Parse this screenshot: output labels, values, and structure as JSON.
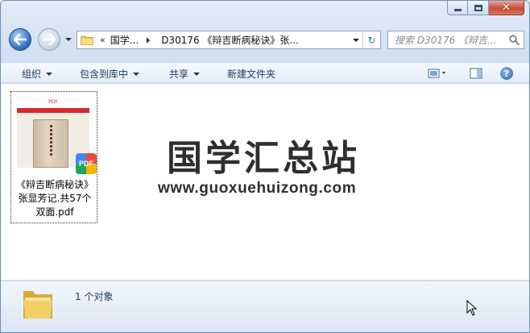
{
  "window": {
    "caption": {
      "minimize": "minimize",
      "maximize": "maximize",
      "close": "✕"
    }
  },
  "nav": {
    "address": {
      "chevrons": "«",
      "crumb1": "国学...",
      "crumb2": "D30176 《辩吉断病秘诀》张..."
    },
    "search_placeholder": "搜索 D30176 《辩吉...",
    "refresh_icon": "↻"
  },
  "toolbar": {
    "organize": "组织",
    "include_in_library": "包含到库中",
    "share": "共享",
    "new_folder": "新建文件夹",
    "help": "?"
  },
  "content": {
    "files": [
      {
        "name_line1": "《辩吉断病秘诀》",
        "name_line2": "张显芳记.共57个",
        "name_line3": "双面.pdf",
        "thumb_label": "PDF",
        "badge": "PDF"
      }
    ],
    "watermark_title": "国学汇总站",
    "watermark_url": "www.guoxuehuizong.com"
  },
  "details": {
    "count_text": "1 个对象"
  },
  "colors": {
    "accent": "#1e395b",
    "frame": "#cfdff1",
    "close": "#c94b35"
  }
}
